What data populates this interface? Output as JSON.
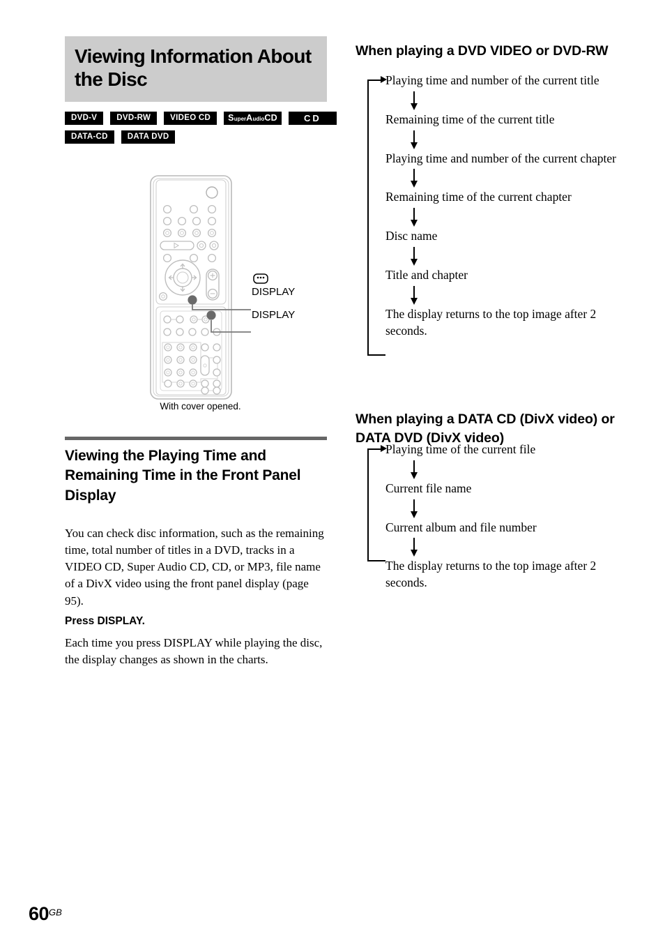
{
  "page": {
    "number": "60",
    "region": "GB"
  },
  "chapter": {
    "title": "Viewing Information About the Disc"
  },
  "disc_badges": {
    "row1": [
      {
        "id": "dvd-v",
        "label": "DVD-V"
      },
      {
        "id": "dvd-rw",
        "label": "DVD-RW"
      },
      {
        "id": "video-cd",
        "label": "VIDEO CD"
      },
      {
        "id": "super-audio-cd",
        "label": "Super Audio CD",
        "part_s": "S",
        "part_uper": "uper",
        "part_a": "A",
        "part_udio": "udio",
        "part_cd": "CD"
      },
      {
        "id": "cd",
        "label": "CD"
      }
    ],
    "row2": [
      {
        "id": "data-cd",
        "label": "DATA-CD"
      },
      {
        "id": "data-dvd",
        "label": "DATA DVD"
      }
    ]
  },
  "figure": {
    "caption": "With cover opened.",
    "callouts": [
      {
        "id": "display-top",
        "label": "DISPLAY"
      },
      {
        "id": "display-bottom",
        "label": "DISPLAY"
      }
    ],
    "button_icon": "display-button-icon"
  },
  "section": {
    "heading": "Viewing the Playing Time and Remaining Time in the Front Panel Display",
    "body1": "You can check disc information, such as the remaining time, total number of titles in a DVD, tracks in a VIDEO CD, Super Audio CD, CD, or MP3, file name of a DivX video using the front panel display (page 95).",
    "press_heading": "Press DISPLAY.",
    "body2": "Each time you press DISPLAY while playing the disc, the display changes as shown in the charts."
  },
  "right_column": {
    "section1": {
      "heading": "When playing a DVD VIDEO or DVD-RW",
      "steps": [
        "Playing time and number of the current title",
        "Remaining time of the current title",
        "Playing time and number of the current chapter",
        "Remaining time of the current chapter",
        "Disc name",
        "Title and chapter",
        "The display returns to the top image after 2 seconds."
      ]
    },
    "section2": {
      "heading": "When playing a DATA CD (DivX video) or DATA DVD (DivX video)",
      "steps": [
        "Playing time of the current file",
        "Current file name",
        "Current album and file number",
        "The display returns to the top image after 2 seconds."
      ]
    }
  },
  "colors": {
    "band_gray": "#cccccc",
    "rule_gray": "#666666",
    "badge_black": "#000000",
    "remote_outline": "#b5b5b5",
    "remote_fill": "#ffffff",
    "callout_dot": "#5a5a5a"
  }
}
